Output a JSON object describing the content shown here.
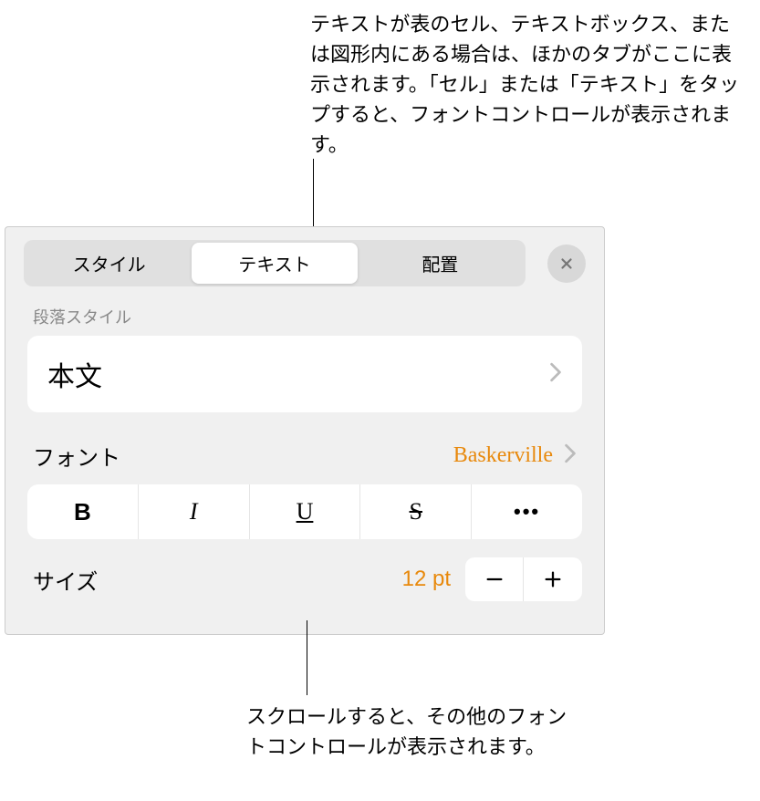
{
  "callouts": {
    "top": "テキストが表のセル、テキストボックス、または図形内にある場合は、ほかのタブがここに表示されます。「セル」または「テキスト」をタップすると、フォントコントロールが表示されます。",
    "bottom": "スクロールすると、その他のフォントコントロールが表示されます。"
  },
  "tabs": {
    "style": "スタイル",
    "text": "テキスト",
    "arrange": "配置"
  },
  "paragraph": {
    "label": "段落スタイル",
    "value": "本文"
  },
  "font": {
    "label": "フォント",
    "value": "Baskerville"
  },
  "styleButtons": {
    "bold": "B",
    "italic": "I",
    "underline": "U",
    "strike": "S",
    "more": "•••"
  },
  "size": {
    "label": "サイズ",
    "value": "12 pt"
  }
}
